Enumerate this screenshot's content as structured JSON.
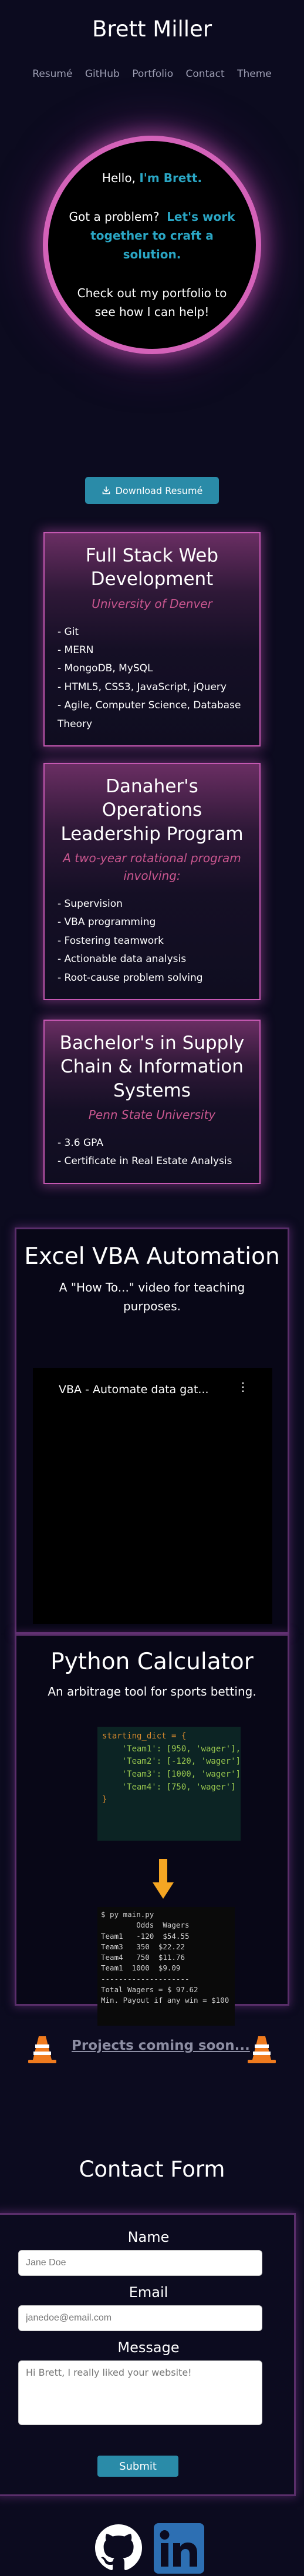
{
  "header": {
    "brand": "Brett Miller",
    "nav": [
      "Resumé",
      "GitHub",
      "Portfolio",
      "Contact",
      "Theme"
    ]
  },
  "hero": {
    "hello_prefix": "Hello, ",
    "hello_name": "I'm Brett.",
    "problem_prefix": "Got a problem?",
    "problem_highlight": "Let's work together to craft a solution.",
    "ask": "Check out my portfolio to see how I can help!"
  },
  "download": {
    "label": "Download Resumé",
    "icon": "download-icon"
  },
  "cards": [
    {
      "title": "Full Stack Web Development",
      "subtitle": "University of Denver",
      "items": [
        "- Git",
        "- MERN",
        "- MongoDB, MySQL",
        "- HTML5, CSS3, JavaScript, jQuery",
        "- Agile, Computer Science, Database Theory"
      ]
    },
    {
      "title": "Danaher's Operations Leadership Program",
      "subtitle": "A two-year rotational program involving:",
      "items": [
        "- Supervision",
        "- VBA programming",
        "- Fostering teamwork",
        "- Actionable data analysis",
        "- Root-cause problem solving"
      ]
    },
    {
      "title": "Bachelor's in Supply Chain & Information Systems",
      "subtitle": "Penn State University",
      "items": [
        "- 3.6 GPA",
        "- Certificate in Real Estate Analysis"
      ]
    }
  ],
  "projects": {
    "vba": {
      "title": "Excel VBA Automation",
      "description": "A \"How To...\" video for teaching purposes.",
      "video_title": "VBA - Automate data gat..."
    },
    "python": {
      "title": "Python Calculator",
      "description": "An arbitrage tool for sports betting.",
      "code_input": [
        "starting_dict = {",
        "    'Team1': [950, 'wager'],",
        "    'Team2': [-120, 'wager'],",
        "    'Team3': [1000, 'wager'],",
        "    'Team4': [750, 'wager']",
        "}"
      ],
      "code_output": [
        "$ py main.py",
        "        Odds  Wagers",
        "Team1   -120  $54.55",
        "Team3   350  $22.22",
        "Team4   750  $11.76",
        "Team1  1000  $9.09",
        "--------------------",
        "Total Wagers = $ 97.62",
        "Min. Payout if any win = $100"
      ]
    }
  },
  "coming_soon": {
    "label": "Projects coming soon..."
  },
  "contact": {
    "title": "Contact Form",
    "name_label": "Name",
    "name_placeholder": "Jane Doe",
    "email_label": "Email",
    "email_placeholder": "janedoe@email.com",
    "message_label": "Message",
    "message_placeholder": "Hi Brett, I really liked your website!",
    "submit_label": "Submit"
  },
  "footer": {
    "icons": [
      "github-icon",
      "linkedin-icon"
    ]
  },
  "colors": {
    "background": "#0c0b1f",
    "accent_teal": "#2aa6c4",
    "accent_pink": "#c9568f",
    "button": "#2a8ba8"
  }
}
